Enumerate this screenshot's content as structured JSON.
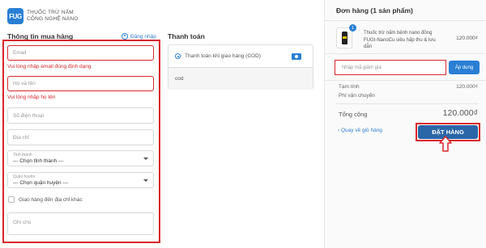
{
  "brand": {
    "logo_mark": "FUG",
    "line1": "THUỐC TRỪ NẤM",
    "line2": "CÔNG NGHỆ NANO"
  },
  "billing": {
    "title": "Thông tin mua hàng",
    "login_label": "Đăng nhập",
    "email_placeholder": "Email",
    "email_error": "Vui lòng nhập email đúng định dạng",
    "name_placeholder": "Họ và tên",
    "name_error": "Vui lòng nhập họ tên",
    "phone_placeholder": "Số điện thoại",
    "address_placeholder": "Địa chỉ",
    "province": {
      "label": "Tỉnh thành",
      "value": "--- Chọn tỉnh thành ---"
    },
    "district": {
      "label": "Quận huyện",
      "value": "--- Chọn quận huyện ---"
    },
    "ship_other_label": "Giao hàng đến địa chỉ khác",
    "note_placeholder": "Ghi chú"
  },
  "payment": {
    "title": "Thanh toán",
    "method_label": "Thanh toán khi giao hàng (COD)",
    "method_note": "cod",
    "icon": "cash-icon"
  },
  "order": {
    "title": "Đơn hàng (1 sản phẩm)",
    "item": {
      "qty": "1",
      "name": "Thuốc trừ nấm bệnh nano đồng FUGI-NanoCu siêu hấp thu & lưu dẫn",
      "price": "120.000₫"
    },
    "discount_placeholder": "Nhập mã giảm giá",
    "apply_label": "Áp dụng",
    "subtotal_label": "Tạm tính",
    "subtotal_value": "120.000₫",
    "shipping_label": "Phí vận chuyển",
    "total_label": "Tổng cộng",
    "total_value": "120.000₫",
    "back_label": "‹ Quay về giỏ hàng",
    "order_button": "ĐẶT HÀNG"
  },
  "colors": {
    "accent": "#2a7fd4",
    "error": "#d9262c",
    "order_button": "#2a66a8"
  }
}
